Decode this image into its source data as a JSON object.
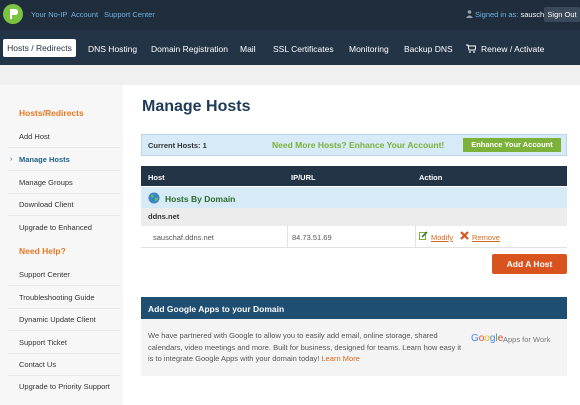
{
  "topbar": {
    "links": [
      "Your No-IP",
      "Account",
      "Support Center"
    ],
    "signed_in_prefix": "Signed in as:",
    "username": "sauschaf",
    "sign_out": "Sign Out"
  },
  "nav": {
    "active": "Hosts / Redirects",
    "items": [
      "DNS Hosting",
      "Domain Registration",
      "Mail",
      "SSL Certificates",
      "Monitoring",
      "Backup DNS",
      "Renew / Activate"
    ]
  },
  "sidebar": {
    "section1_title": "Hosts/Redirects",
    "section1_items": [
      "Add Host",
      "Manage Hosts",
      "Manage Groups",
      "Download Client",
      "Upgrade to Enhanced"
    ],
    "active_item": "Manage Hosts",
    "section2_title": "Need Help?",
    "section2_items": [
      "Support Center",
      "Troubleshooting Guide",
      "Dynamic Update Client",
      "Support Ticket",
      "Contact Us",
      "Upgrade to Priority Support"
    ]
  },
  "main": {
    "title": "Manage Hosts",
    "current_hosts_label": "Current Hosts:",
    "current_hosts_count": "1",
    "upsell_text": "Need More Hosts? Enhance Your Account!",
    "enhance_button": "Enhance Your Account",
    "table": {
      "headers": [
        "Host",
        "IP/URL",
        "Action"
      ],
      "group_label": "Hosts By Domain",
      "domain": "ddns.net",
      "rows": [
        {
          "host": "sauschaf.ddns.net",
          "ip": "84.73.51.69",
          "modify": "Modify",
          "remove": "Remove"
        }
      ]
    },
    "add_host_button": "Add A Host"
  },
  "google_apps": {
    "title": "Add Google Apps to your Domain",
    "body": "We have partnered with Google to allow you to easily add email, online storage, shared calendars, video meetings and more. Built for business, designed for teams. Learn how easy it is to integrate Google Apps with your domain today!",
    "learn_more": "Learn More",
    "logo_text": "Google",
    "apps_label": "Apps for Work"
  },
  "colors": {
    "topbar": "#1f2d3d",
    "navbar": "#243447",
    "accent_orange": "#d9531e",
    "accent_green": "#7cb13a",
    "info_blue": "#d7eaf7"
  }
}
